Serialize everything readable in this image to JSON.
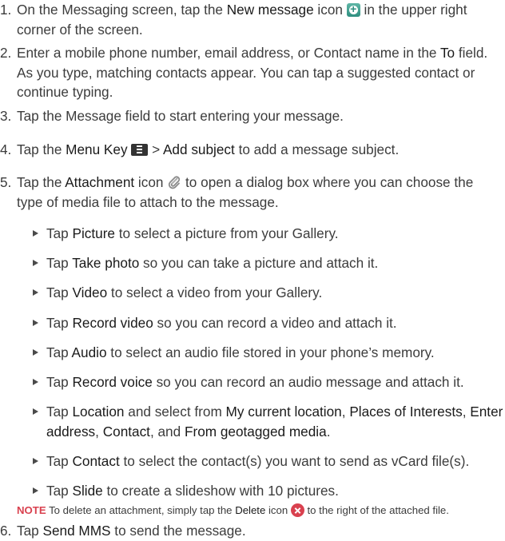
{
  "steps": [
    {
      "num": "1.",
      "parts": [
        {
          "t": "On the Messaging screen, tap the "
        },
        {
          "t": "New message",
          "b": true
        },
        {
          "t": " icon "
        },
        {
          "icon": "new-message-icon"
        },
        {
          "t": " in the upper right corner of the screen."
        }
      ]
    },
    {
      "num": "2.",
      "parts": [
        {
          "t": "Enter a mobile phone number, email address, or Contact name in the "
        },
        {
          "t": "To",
          "b": true
        },
        {
          "t": " field. As you type, matching contacts appear. You can tap a suggested contact or continue typing."
        }
      ]
    },
    {
      "num": "3.",
      "parts": [
        {
          "t": "Tap the Message field to start entering your message."
        }
      ]
    },
    {
      "num": "4.",
      "parts": [
        {
          "t": "Tap the "
        },
        {
          "t": "Menu Key",
          "b": true
        },
        {
          "t": " "
        },
        {
          "icon": "menu-key-icon"
        },
        {
          "t": " > "
        },
        {
          "t": "Add subject",
          "b": true
        },
        {
          "t": " to add a message subject."
        }
      ]
    },
    {
      "num": "5.",
      "parts": [
        {
          "t": "Tap the "
        },
        {
          "t": "Attachment",
          "b": true
        },
        {
          "t": " icon "
        },
        {
          "icon": "paperclip-icon"
        },
        {
          "t": " to open a dialog box where you can choose the type of media file to attach to the message."
        }
      ]
    },
    {
      "num": "6.",
      "parts": [
        {
          "t": "Tap "
        },
        {
          "t": "Send MMS",
          "b": true
        },
        {
          "t": " to send the message."
        }
      ]
    }
  ],
  "subitems": [
    {
      "parts": [
        {
          "t": "Tap "
        },
        {
          "t": "Picture",
          "b": true
        },
        {
          "t": " to select a picture from your Gallery."
        }
      ]
    },
    {
      "parts": [
        {
          "t": "Tap "
        },
        {
          "t": "Take photo",
          "b": true
        },
        {
          "t": " so you can take a picture and attach it."
        }
      ]
    },
    {
      "parts": [
        {
          "t": "Tap "
        },
        {
          "t": "Video",
          "b": true
        },
        {
          "t": " to select a video from your Gallery."
        }
      ]
    },
    {
      "parts": [
        {
          "t": "Tap "
        },
        {
          "t": "Record video",
          "b": true
        },
        {
          "t": " so you can record a video and attach it."
        }
      ]
    },
    {
      "parts": [
        {
          "t": "Tap "
        },
        {
          "t": "Audio",
          "b": true
        },
        {
          "t": " to select an audio file stored in your phone’s memory."
        }
      ]
    },
    {
      "parts": [
        {
          "t": "Tap "
        },
        {
          "t": "Record voice",
          "b": true
        },
        {
          "t": " so you can record an audio message and attach it."
        }
      ]
    },
    {
      "parts": [
        {
          "t": "Tap "
        },
        {
          "t": "Location",
          "b": true
        },
        {
          "t": " and select from "
        },
        {
          "t": "My current location",
          "b": true
        },
        {
          "t": ", "
        },
        {
          "t": "Places of Interests",
          "b": true
        },
        {
          "t": ", "
        },
        {
          "t": "Enter address",
          "b": true
        },
        {
          "t": ", "
        },
        {
          "t": "Contact",
          "b": true
        },
        {
          "t": ", and "
        },
        {
          "t": "From geotagged media",
          "b": true
        },
        {
          "t": "."
        }
      ]
    },
    {
      "parts": [
        {
          "t": "Tap "
        },
        {
          "t": "Contact",
          "b": true
        },
        {
          "t": " to select the contact(s) you want to send as vCard file(s)."
        }
      ]
    },
    {
      "parts": [
        {
          "t": "Tap "
        },
        {
          "t": "Slide",
          "b": true
        },
        {
          "t": " to create a slideshow with 10 pictures."
        }
      ]
    }
  ],
  "note": {
    "label": "NOTE",
    "parts": [
      {
        "t": " To delete an attachment, simply tap the "
      },
      {
        "t": "Delete",
        "b": true
      },
      {
        "t": " icon "
      },
      {
        "icon": "delete-icon"
      },
      {
        "t": " to the right of the attached file."
      }
    ]
  },
  "colors": {
    "text": "#3c3c3c",
    "note_label": "#d9414f",
    "new_message_icon": "#2f8f80",
    "delete_icon": "#d9414f"
  }
}
